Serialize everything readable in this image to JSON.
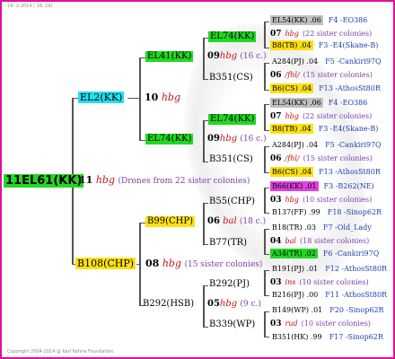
{
  "timestamp": "19-  2-2014 ( 18: 19)",
  "copyright": "Copyright 2004-2014 @ Karl Kehrle Foundation.",
  "colors": {
    "border": "#e0109a",
    "green": "#22d822",
    "cyan": "#22e0f0",
    "yellow": "#ffe010",
    "gray": "#c0c0c0",
    "magenta": "#e040e0",
    "hbg": "#cc1111",
    "note": "#7a3fa8",
    "link": "#1f3fb0"
  },
  "root": {
    "id": "11EL61(KK)",
    "num": "11",
    "mark": "hbg",
    "note": "(Drones from 22 sister colonies)"
  },
  "g1": [
    {
      "id": "EL2(KK)",
      "num": "10",
      "mark": "hbg"
    },
    {
      "id": "B108(CHP)",
      "num": "08",
      "mark": "hbg",
      "note": "(15 sister colonies)"
    }
  ],
  "g2": [
    {
      "id": "EL41(KK)",
      "num": "09",
      "mark": "hbg",
      "note": "(16 c.)"
    },
    {
      "id": "EL74(KK)",
      "num": "09",
      "mark": "hbg",
      "note": "(16 c.)"
    },
    {
      "id": "B99(CHP)",
      "num": "06",
      "mark": "bal",
      "note": "(18 c.)"
    },
    {
      "id": "B292(HSB)",
      "num": "05",
      "mark": "hbg",
      "note": "(9 c.)"
    }
  ],
  "g3": [
    "EL74(KK)",
    "B351(CS)",
    "EL74(KK)",
    "B351(CS)",
    "B55(CHP)",
    "B77(TR)",
    "B292(PJ)",
    "B339(WP)"
  ],
  "g4": [
    {
      "id": "EL54(KK) .06",
      "link": "F4 -EO386"
    },
    {
      "num": "07",
      "mark": "hbg",
      "note": "(22 sister colonies)"
    },
    {
      "id": "B8(TB) .04",
      "link": "F3 -E4(Skane-B)"
    },
    {
      "id": "A284(PJ) .04",
      "link": "F5 -Cankiri97Q"
    },
    {
      "num": "06",
      "mark": "/fhl/",
      "note": "(15 sister colonies)"
    },
    {
      "id": "B6(CS) .04",
      "link": "F13 -AthosSt80R"
    },
    {
      "id": "EL54(KK) .06",
      "link": "F4 -EO386"
    },
    {
      "num": "07",
      "mark": "hbg",
      "note": "(22 sister colonies)"
    },
    {
      "id": "B8(TB) .04",
      "link": "F3 -E4(Skane-B)"
    },
    {
      "id": "A284(PJ) .04",
      "link": "F5 -Cankiri97Q"
    },
    {
      "num": "06",
      "mark": "/fhl/",
      "note": "(15 sister colonies)"
    },
    {
      "id": "B6(CS) .04",
      "link": "F13 -AthosSt80R"
    },
    {
      "id": "B66(KK) .01",
      "link": "F3 -B262(NE)"
    },
    {
      "num": "03",
      "mark": "hbg",
      "note": "(10 sister colonies)"
    },
    {
      "id": "B137(FF) .99",
      "link": "F18 -Sinop62R"
    },
    {
      "id": "B18(TR) .03",
      "link": "F7 -Old_Lady"
    },
    {
      "num": "04",
      "mark": "bal",
      "note": "(18 sister colonies)"
    },
    {
      "id": "A34(TR) .02",
      "link": "F6 -Cankiri97Q"
    },
    {
      "id": "B191(PJ) .01",
      "link": "F12 -AthosSt80R"
    },
    {
      "num": "03",
      "mark": "ins",
      "note": "(10 sister colonies)"
    },
    {
      "id": "B216(PJ) .00",
      "link": "F11 -AthosSt80R"
    },
    {
      "id": "B149(WP) .01",
      "link": "F20 -Sinop62R"
    },
    {
      "num": "03",
      "mark": "rud",
      "note": "(10 sister colonies)"
    },
    {
      "id": "B351(HK) .99",
      "link": "F17 -Sinop62R"
    }
  ]
}
